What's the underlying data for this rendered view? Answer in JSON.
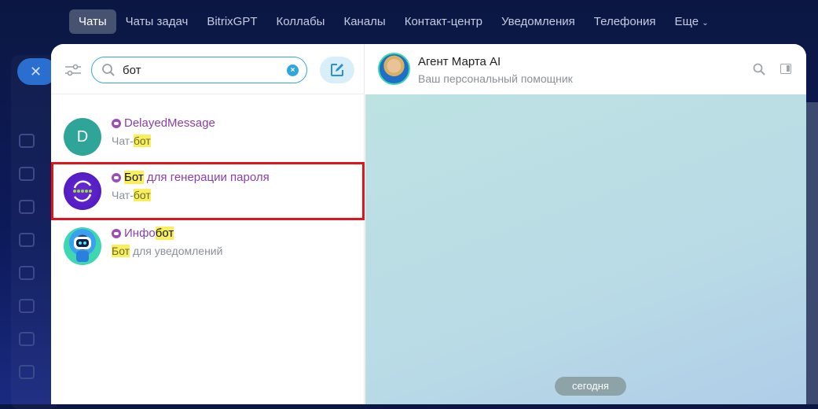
{
  "topnav": {
    "items": [
      "Чаты",
      "Чаты задач",
      "BitrixGPT",
      "Коллабы",
      "Каналы",
      "Контакт-центр",
      "Уведомления",
      "Телефония",
      "Еще"
    ]
  },
  "search": {
    "value": "бот"
  },
  "results": [
    {
      "name_pre": "",
      "name_hl": "",
      "name_post": "DelayedMessage",
      "sub_pre": "Чат-",
      "sub_hl": "бот",
      "sub_post": "",
      "avatar_letter": "D",
      "avatar_color": "#2fa59a"
    },
    {
      "name_pre": "",
      "name_hl": "Бот",
      "name_post": " для генерации пароля",
      "sub_pre": "Чат-",
      "sub_hl": "бот",
      "sub_post": "",
      "avatar_color": "#5a21c8"
    },
    {
      "name_pre": "Инфо",
      "name_hl": "бот",
      "name_post": "",
      "sub_pre": "",
      "sub_hl": "Бот",
      "sub_post": " для уведомлений",
      "avatar_color": "#3fd7b0"
    }
  ],
  "chat": {
    "name": "Агент Марта AI",
    "subtitle": "Ваш персональный помощник",
    "date_divider": "сегодня"
  },
  "colors": {
    "accent": "#2fa6e0",
    "bot_name": "#8a3fa5",
    "highlight": "#f8ef5a",
    "selection": "#e0141a"
  }
}
